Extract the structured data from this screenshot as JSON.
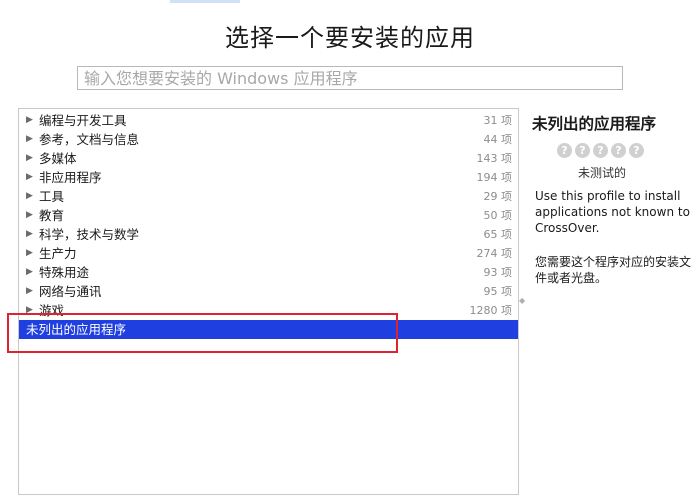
{
  "title": "选择一个要安装的应用",
  "search": {
    "placeholder": "输入您想要安装的 Windows 应用程序",
    "value": ""
  },
  "categories": [
    {
      "label": "编程与开发工具",
      "count": "31 项"
    },
    {
      "label": "参考，文档与信息",
      "count": "44 项"
    },
    {
      "label": "多媒体",
      "count": "143 项"
    },
    {
      "label": "非应用程序",
      "count": "194 项"
    },
    {
      "label": "工具",
      "count": "29 项"
    },
    {
      "label": "教育",
      "count": "50 项"
    },
    {
      "label": "科学，技术与数学",
      "count": "65 项"
    },
    {
      "label": "生产力",
      "count": "274 项"
    },
    {
      "label": "特殊用途",
      "count": "93 项"
    },
    {
      "label": "网络与通讯",
      "count": "95 项"
    },
    {
      "label": "游戏",
      "count": "1280 项"
    }
  ],
  "selected_item": {
    "label": "未列出的应用程序"
  },
  "detail": {
    "title": "未列出的应用程序",
    "rating": {
      "max": 5,
      "value": 0,
      "symbol": "?",
      "label": "未测试的"
    },
    "description": "Use this profile to install applications not known to CrossOver.",
    "note": "您需要这个程序对应的安装文件或者光盘。"
  },
  "colors": {
    "selection": "#1f3fe0",
    "highlight_box": "#e0222e",
    "rating_dot": "#d0d0d0"
  },
  "icons": {
    "disclosure": "disclosure-triangle-icon",
    "rating": "question-mark-rating-icon",
    "splitter": "resize-handle-icon"
  }
}
